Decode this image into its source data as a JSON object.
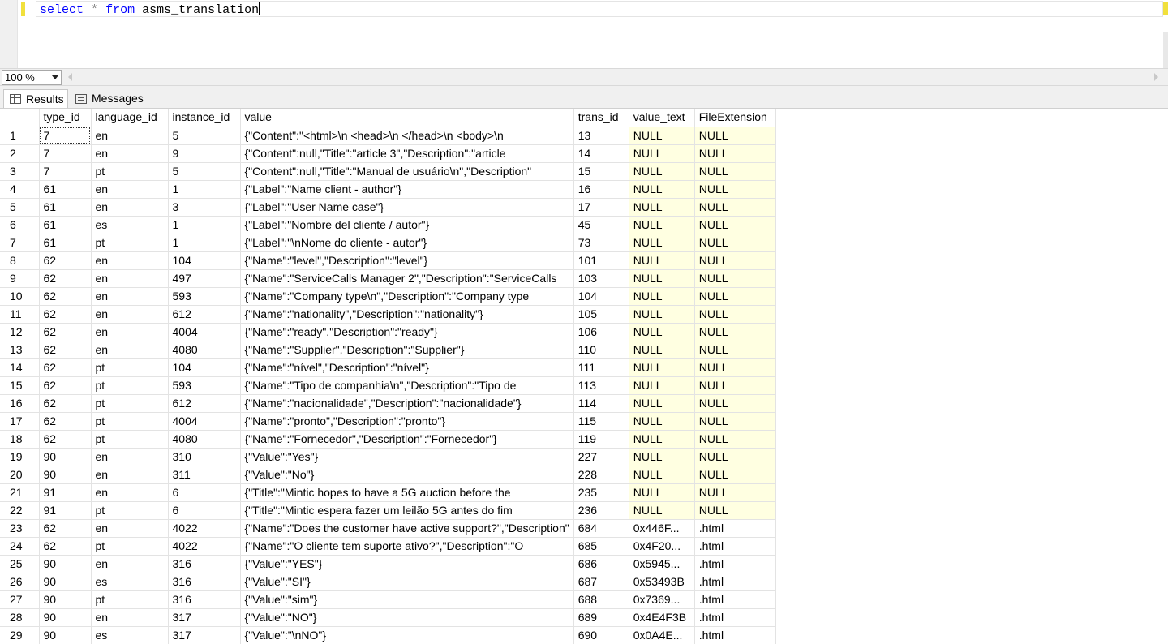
{
  "editor": {
    "query_keyword_select": "select",
    "query_star": "*",
    "query_keyword_from": "from",
    "query_table": "asms_translation"
  },
  "zoom": {
    "value": "100 %"
  },
  "tabs": [
    {
      "label": "Results",
      "icon": "grid-icon",
      "active": true
    },
    {
      "label": "Messages",
      "icon": "messages-icon",
      "active": false
    }
  ],
  "grid": {
    "columns": [
      "type_id",
      "language_id",
      "instance_id",
      "value",
      "trans_id",
      "value_text",
      "FileExtension"
    ],
    "rows": [
      [
        "1",
        "7",
        "en",
        "5",
        "{\"Content\":\"<html>\\n    <head>\\n    </head>\\n    <body>\\n",
        "13",
        "NULL",
        "NULL"
      ],
      [
        "2",
        "7",
        "en",
        "9",
        "{\"Content\":null,\"Title\":\"article 3\",\"Description\":\"article",
        "14",
        "NULL",
        "NULL"
      ],
      [
        "3",
        "7",
        "pt",
        "5",
        "{\"Content\":null,\"Title\":\"Manual de usuário\\n\",\"Description\"",
        "15",
        "NULL",
        "NULL"
      ],
      [
        "4",
        "61",
        "en",
        "1",
        "{\"Label\":\"Name client - author\"}",
        "16",
        "NULL",
        "NULL"
      ],
      [
        "5",
        "61",
        "en",
        "3",
        "{\"Label\":\"User Name case\"}",
        "17",
        "NULL",
        "NULL"
      ],
      [
        "6",
        "61",
        "es",
        "1",
        "{\"Label\":\"Nombre del cliente / autor\"}",
        "45",
        "NULL",
        "NULL"
      ],
      [
        "7",
        "61",
        "pt",
        "1",
        "{\"Label\":\"\\nNome do cliente - autor\"}",
        "73",
        "NULL",
        "NULL"
      ],
      [
        "8",
        "62",
        "en",
        "104",
        "{\"Name\":\"level\",\"Description\":\"level\"}",
        "101",
        "NULL",
        "NULL"
      ],
      [
        "9",
        "62",
        "en",
        "497",
        "{\"Name\":\"ServiceCalls Manager 2\",\"Description\":\"ServiceCalls",
        "103",
        "NULL",
        "NULL"
      ],
      [
        "10",
        "62",
        "en",
        "593",
        "{\"Name\":\"Company type\\n\",\"Description\":\"Company type",
        "104",
        "NULL",
        "NULL"
      ],
      [
        "11",
        "62",
        "en",
        "612",
        "{\"Name\":\"nationality\",\"Description\":\"nationality\"}",
        "105",
        "NULL",
        "NULL"
      ],
      [
        "12",
        "62",
        "en",
        "4004",
        "{\"Name\":\"ready\",\"Description\":\"ready\"}",
        "106",
        "NULL",
        "NULL"
      ],
      [
        "13",
        "62",
        "en",
        "4080",
        "{\"Name\":\"Supplier\",\"Description\":\"Supplier\"}",
        "110",
        "NULL",
        "NULL"
      ],
      [
        "14",
        "62",
        "pt",
        "104",
        "{\"Name\":\"nível\",\"Description\":\"nível\"}",
        "111",
        "NULL",
        "NULL"
      ],
      [
        "15",
        "62",
        "pt",
        "593",
        "{\"Name\":\"Tipo de companhia\\n\",\"Description\":\"Tipo de",
        "113",
        "NULL",
        "NULL"
      ],
      [
        "16",
        "62",
        "pt",
        "612",
        "{\"Name\":\"nacionalidade\",\"Description\":\"nacionalidade\"}",
        "114",
        "NULL",
        "NULL"
      ],
      [
        "17",
        "62",
        "pt",
        "4004",
        "{\"Name\":\"pronto\",\"Description\":\"pronto\"}",
        "115",
        "NULL",
        "NULL"
      ],
      [
        "18",
        "62",
        "pt",
        "4080",
        "{\"Name\":\"Fornecedor\",\"Description\":\"Fornecedor\"}",
        "119",
        "NULL",
        "NULL"
      ],
      [
        "19",
        "90",
        "en",
        "310",
        "{\"Value\":\"Yes\"}",
        "227",
        "NULL",
        "NULL"
      ],
      [
        "20",
        "90",
        "en",
        "311",
        "{\"Value\":\"No\"}",
        "228",
        "NULL",
        "NULL"
      ],
      [
        "21",
        "91",
        "en",
        "6",
        "{\"Title\":\"Mintic hopes to have a 5G auction before the",
        "235",
        "NULL",
        "NULL"
      ],
      [
        "22",
        "91",
        "pt",
        "6",
        "{\"Title\":\"Mintic espera fazer um leilão 5G antes do fim",
        "236",
        "NULL",
        "NULL"
      ],
      [
        "23",
        "62",
        "en",
        "4022",
        "{\"Name\":\"Does the customer have active support?\",\"Description\"",
        "684",
        "0x446F...",
        ".html"
      ],
      [
        "24",
        "62",
        "pt",
        "4022",
        "{\"Name\":\"O cliente tem suporte ativo?\",\"Description\":\"O",
        "685",
        "0x4F20...",
        ".html"
      ],
      [
        "25",
        "90",
        "en",
        "316",
        "{\"Value\":\"YES\"}",
        "686",
        "0x5945...",
        ".html"
      ],
      [
        "26",
        "90",
        "es",
        "316",
        "{\"Value\":\"SI\"}",
        "687",
        "0x53493B",
        ".html"
      ],
      [
        "27",
        "90",
        "pt",
        "316",
        "{\"Value\":\"sim\"}",
        "688",
        "0x7369...",
        ".html"
      ],
      [
        "28",
        "90",
        "en",
        "317",
        "{\"Value\":\"NO\"}",
        "689",
        "0x4E4F3B",
        ".html"
      ],
      [
        "29",
        "90",
        "es",
        "317",
        "{\"Value\":\"\\nNO\"}",
        "690",
        "0x0A4E...",
        ".html"
      ]
    ],
    "highlight_color": "#ffffe1"
  }
}
